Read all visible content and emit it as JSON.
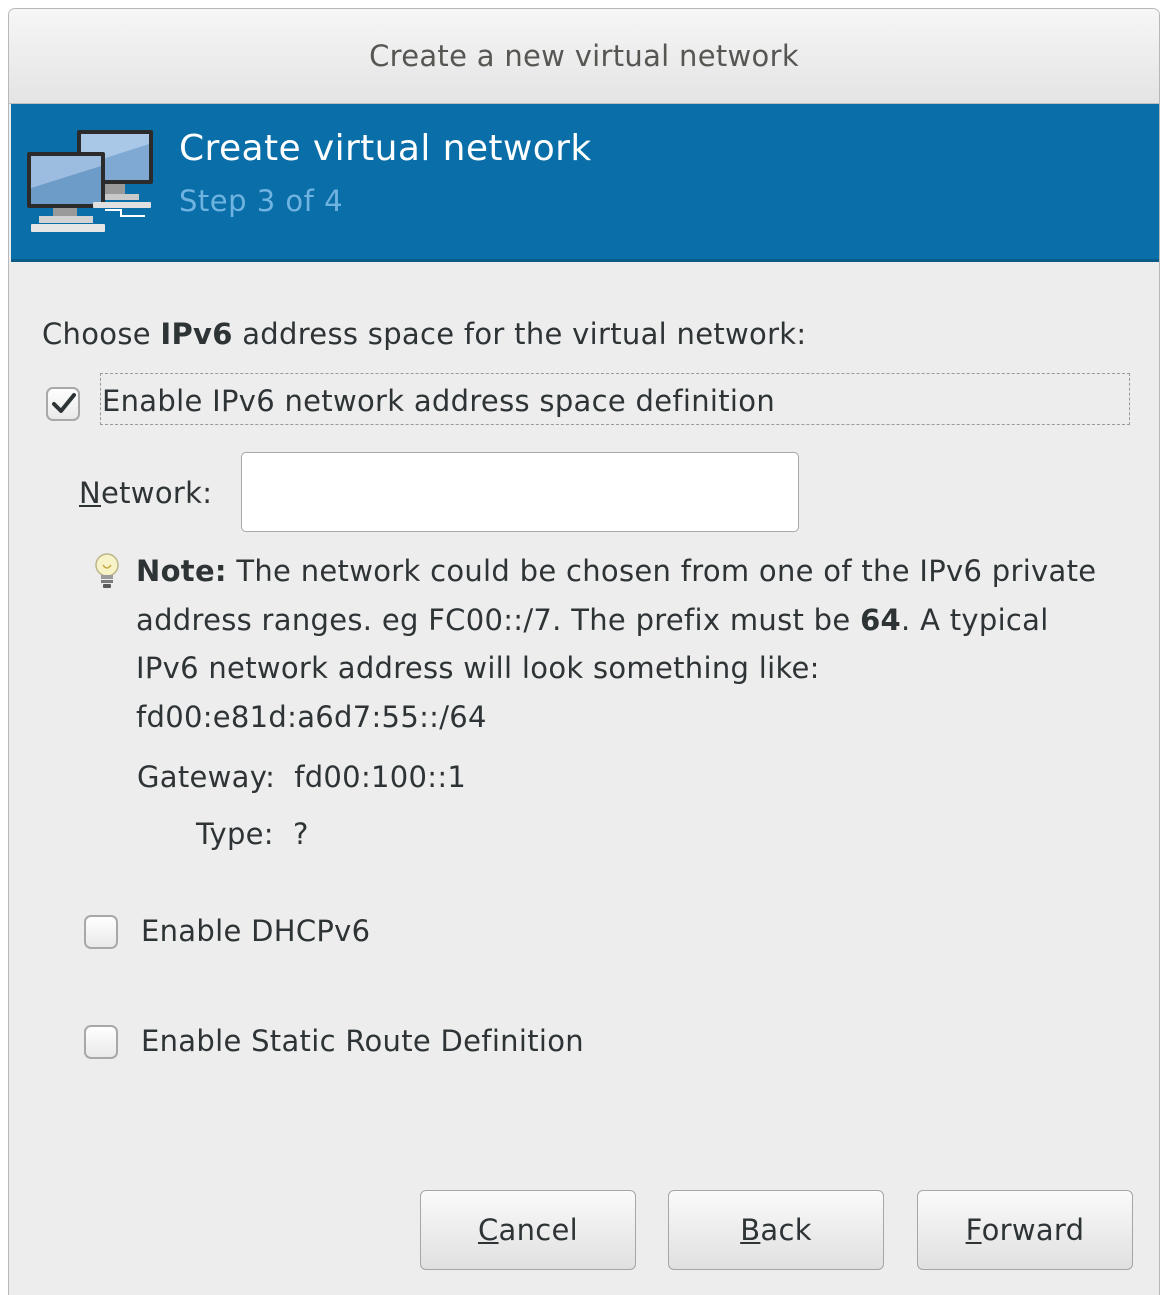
{
  "window": {
    "title": "Create a new virtual network"
  },
  "banner": {
    "title": "Create virtual network",
    "subtitle": "Step 3 of 4",
    "icon": "network-computers-icon",
    "background_color": "#0a6ea8"
  },
  "form": {
    "choose_prefix": "Choose ",
    "choose_bold": "IPv6",
    "choose_suffix": " address space for the virtual network:",
    "enable_ipv6": {
      "label": "Enable IPv6 network address space definition",
      "checked": true
    },
    "network": {
      "label_mnemonic": "N",
      "label_rest": "etwork:",
      "value": "",
      "placeholder": ""
    },
    "note": {
      "icon": "lightbulb-icon",
      "bold_label": "Note:",
      "text_part1": " The network could be chosen from one of the IPv6 private address ranges. eg FC00::/7.  The prefix must be ",
      "prefix_bold": "64",
      "text_part2": ". A typical IPv6 network address will look something like: fd00:e81d:a6d7:55::/64"
    },
    "gateway": {
      "label": "Gateway:",
      "value": "fd00:100::1"
    },
    "type": {
      "label": "Type:",
      "value": "?"
    },
    "enable_dhcpv6": {
      "label": "Enable DHCPv6",
      "checked": false
    },
    "enable_static_route": {
      "label": "Enable Static Route Definition",
      "checked": false
    }
  },
  "buttons": {
    "cancel": {
      "mnemonic": "C",
      "rest": "ancel"
    },
    "back": {
      "mnemonic": "B",
      "rest": "ack"
    },
    "forward": {
      "mnemonic": "F",
      "rest": "orward"
    }
  }
}
